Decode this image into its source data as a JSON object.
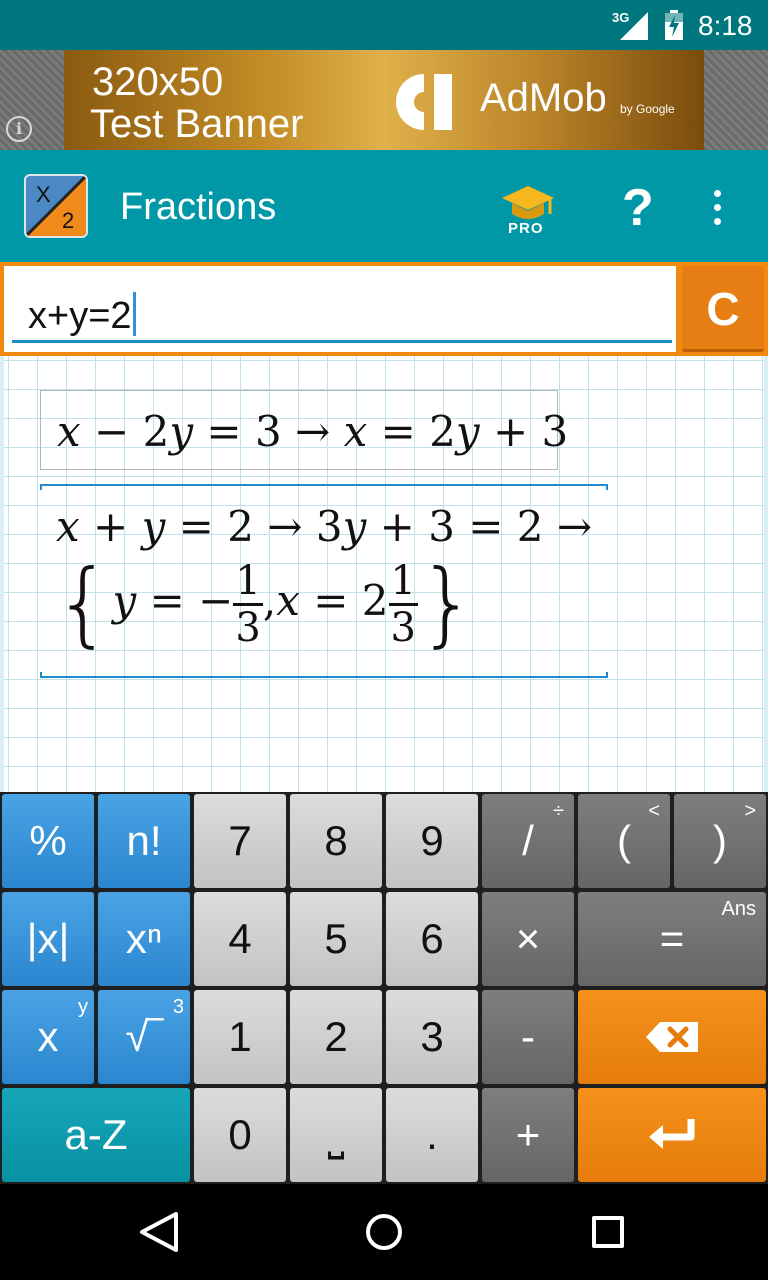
{
  "status_bar": {
    "network": "3G",
    "time": "8:18",
    "icons": [
      "signal-icon",
      "battery-icon"
    ]
  },
  "ad_banner": {
    "line1": "320x50",
    "line2": "Test Banner",
    "brand": "AdMob",
    "by": "by Google",
    "info_icon": "info-icon"
  },
  "app_bar": {
    "title": "Fractions",
    "pro_label": "PRO",
    "help_label": "?",
    "logo": {
      "top": "X",
      "bottom": "2"
    },
    "icons": [
      "pro-graduation-cap-icon",
      "help-icon",
      "more-vert-icon"
    ]
  },
  "input": {
    "value": "x+y=2",
    "clear_label": "C"
  },
  "results": {
    "line1": {
      "lhs": [
        "x",
        " − 2",
        "y",
        " = 3 → "
      ],
      "rhs": [
        "x",
        " = 2",
        "y",
        " + 3"
      ]
    },
    "line2": {
      "part1": [
        "x",
        " + ",
        "y",
        " = 2 → 3",
        "y",
        " + 3 = 2 →"
      ]
    },
    "solution": {
      "open": "{",
      "var1": "y",
      "eq1": " = −",
      "frac1": {
        "num": "1",
        "den": "3"
      },
      "sep": ",",
      "var2": "x",
      "eq2": " = 2",
      "frac2": {
        "num": "1",
        "den": "3"
      },
      "close": "}"
    }
  },
  "keyboard": {
    "rows": [
      [
        {
          "label": "%",
          "sup": "",
          "style": "blue"
        },
        {
          "label": "n!",
          "sup": "",
          "style": "blue"
        },
        {
          "label": "7",
          "sup": "",
          "style": "gray"
        },
        {
          "label": "8",
          "sup": "",
          "style": "gray"
        },
        {
          "label": "9",
          "sup": "",
          "style": "gray"
        },
        {
          "label": "/",
          "sup": "÷",
          "style": "dark"
        },
        {
          "label": "(",
          "sup": "<",
          "style": "dark"
        },
        {
          "label": ")",
          "sup": ">",
          "style": "dark"
        }
      ],
      [
        {
          "label": "|x|",
          "sup": "",
          "style": "blue"
        },
        {
          "label": "xⁿ",
          "sup": "",
          "style": "blue"
        },
        {
          "label": "4",
          "sup": "",
          "style": "gray"
        },
        {
          "label": "5",
          "sup": "",
          "style": "gray"
        },
        {
          "label": "6",
          "sup": "",
          "style": "gray"
        },
        {
          "label": "×",
          "sup": "",
          "style": "dark"
        },
        {
          "label": "=",
          "sup": "Ans",
          "style": "dark"
        }
      ],
      [
        {
          "label": "x",
          "sup": "y",
          "style": "blue"
        },
        {
          "label": "√‾",
          "sup": "3",
          "style": "blue"
        },
        {
          "label": "1",
          "sup": "",
          "style": "gray"
        },
        {
          "label": "2",
          "sup": "",
          "style": "gray"
        },
        {
          "label": "3",
          "sup": "",
          "style": "gray"
        },
        {
          "label": "-",
          "sup": "",
          "style": "dark"
        },
        {
          "label": "",
          "sup": "",
          "style": "orange",
          "icon": "backspace-icon"
        }
      ],
      [
        {
          "label": "a-Z",
          "sup": "",
          "style": "teal"
        },
        {
          "label": "0",
          "sup": "",
          "style": "gray"
        },
        {
          "label": "⎵",
          "sup": "",
          "style": "gray"
        },
        {
          "label": ".",
          "sup": "",
          "style": "gray"
        },
        {
          "label": "+",
          "sup": "",
          "style": "dark"
        },
        {
          "label": "",
          "sup": "",
          "style": "orange",
          "icon": "enter-icon"
        }
      ]
    ]
  },
  "nav_bar": {
    "icons": [
      "back-icon",
      "home-icon",
      "recents-icon"
    ]
  },
  "colors": {
    "status": "#00777e",
    "appbar": "#0097a7",
    "accent_orange": "#f28a12",
    "key_blue": "#2a86cf",
    "key_teal": "#0891a3"
  }
}
